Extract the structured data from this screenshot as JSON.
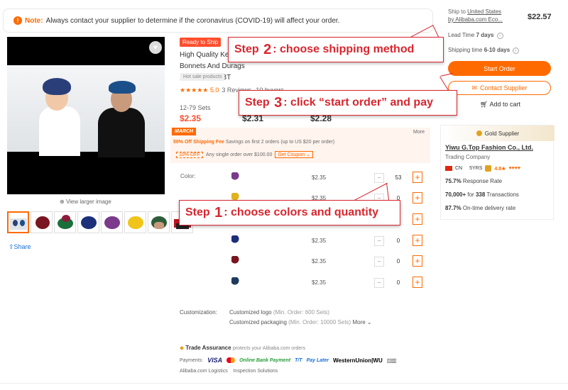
{
  "notice": {
    "label": "Note:",
    "text": "Always contact your supplier to determine if the coronavirus (COVID-19) will affect your order."
  },
  "media": {
    "view_larger": "View larger image",
    "share": "Share"
  },
  "product": {
    "ready_badge": "Ready to Ship",
    "title": "High Quality Ke... Bonnets And Durags 13M-4T14/05BT",
    "hot_tag": "Hot sale products",
    "stars": "★★★★★",
    "rating": "5.0",
    "reviews": "3 Reviews",
    "buyers": "10 buyers"
  },
  "tiers": {
    "qty": "12-79 Sets",
    "prices": [
      "$2.35",
      "$2.31",
      "$2.28"
    ]
  },
  "promo": {
    "march": "MARCH",
    "more": "More",
    "shipping_fee": "50% Off Shipping Fee",
    "shipping_note": "Savings on first 2 orders (up to US $20 per order)",
    "off_label": "10% OFF",
    "off_note": "Any single order over $100.00",
    "coupon": "Get Coupon"
  },
  "variants": {
    "label": "Color:",
    "rows": [
      {
        "price": "$2.35",
        "qty": "53",
        "color": "#7b3a8c"
      },
      {
        "price": "$2.35",
        "qty": "0",
        "color": "#e0b21c"
      },
      {
        "price": "$2.35",
        "qty": "0",
        "color": "#222222"
      },
      {
        "price": "$2.35",
        "qty": "0",
        "color": "#1b2f7a"
      },
      {
        "price": "$2.35",
        "qty": "0",
        "color": "#7a1620"
      },
      {
        "price": "$2.35",
        "qty": "0",
        "color": "#1e3b5c"
      }
    ],
    "minus": "−",
    "plus": "+"
  },
  "customization": {
    "label": "Customization:",
    "logo": "Customized logo",
    "logo_min": "(Min. Order: 600 Sets)",
    "packaging": "Customized packaging",
    "packaging_min": "(Min. Order: 10000 Sets)",
    "more": "More"
  },
  "trade": {
    "title": "Trade Assurance",
    "subtitle": "protects your Alibaba.com orders"
  },
  "payments": {
    "label": "Payments:",
    "visa": "VISA",
    "obp": "Online Bank Payment",
    "tt": "T/T",
    "paylater": "Pay Later",
    "wu": "WesternUnion",
    "wu2": "WU"
  },
  "logistics": {
    "a": "Alibaba.com Logistics",
    "b": "Inspection Solutions"
  },
  "sidebar": {
    "ship_to": "Ship to",
    "ship_country": "United States",
    "ship_by": "by Alibaba.com Eco...",
    "ship_price": "$22.57",
    "lead_time_label": "Lead Time",
    "lead_time": "7 days",
    "shipping_time_label": "Shipping time",
    "shipping_time": "6-10 days",
    "start_order": "Start Order",
    "contact_supplier": "Contact Supplier",
    "add_to_cart": "Add to cart"
  },
  "supplier": {
    "badge": "Gold Supplier",
    "name": "Yiwu G.Top Fashion Co., Ltd.",
    "type": "Trading Company",
    "country": "CN",
    "years": "5YRS",
    "score": "4.8★",
    "hearts": "♥♥♥♥",
    "response_rate": "75.7%",
    "response_label": "Response Rate",
    "transactions": "70,000+",
    "transactions_for": "for",
    "transactions_count": "338",
    "transactions_label": "Transactions",
    "ontime": "87.7%",
    "ontime_label": "On-time delivery rate"
  },
  "callouts": {
    "s2_pre": "Step",
    "s2_num": "2",
    "s2_text": ": choose shipping method",
    "s3_pre": "Step",
    "s3_num": "3",
    "s3_text": ": click “start order” and pay",
    "s1_pre": "Step",
    "s1_num": "1",
    "s1_text": ": choose colors and quantity"
  },
  "icons": {
    "notice": "info-icon",
    "fav": "heart-icon",
    "zoom": "zoom-icon",
    "share": "share-icon",
    "mail": "mail-icon",
    "cart": "cart-icon"
  }
}
